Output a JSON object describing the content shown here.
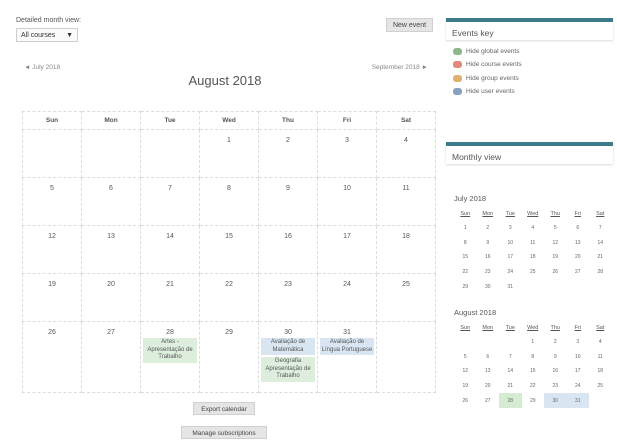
{
  "main": {
    "detailed_label": "Detailed month view:",
    "course_select": "All courses",
    "new_event": "New event",
    "prev_month": "◄ July 2018",
    "next_month": "September 2018 ►",
    "month_title": "August 2018",
    "weekdays": [
      "Sun",
      "Mon",
      "Tue",
      "Wed",
      "Thu",
      "Fri",
      "Sat"
    ],
    "weeks": [
      [
        {
          "d": ""
        },
        {
          "d": ""
        },
        {
          "d": ""
        },
        {
          "d": "1"
        },
        {
          "d": "2"
        },
        {
          "d": "3"
        },
        {
          "d": "4"
        }
      ],
      [
        {
          "d": "5"
        },
        {
          "d": "6"
        },
        {
          "d": "7"
        },
        {
          "d": "8"
        },
        {
          "d": "9"
        },
        {
          "d": "10"
        },
        {
          "d": "11"
        }
      ],
      [
        {
          "d": "12"
        },
        {
          "d": "13"
        },
        {
          "d": "14"
        },
        {
          "d": "15"
        },
        {
          "d": "16"
        },
        {
          "d": "17"
        },
        {
          "d": "18"
        }
      ],
      [
        {
          "d": "19"
        },
        {
          "d": "20"
        },
        {
          "d": "21"
        },
        {
          "d": "22"
        },
        {
          "d": "23"
        },
        {
          "d": "24"
        },
        {
          "d": "25"
        }
      ],
      [
        {
          "d": "26"
        },
        {
          "d": "27"
        },
        {
          "d": "28",
          "events": [
            {
              "t": "Artes - Apresentação de Trabalho",
              "type": "course"
            }
          ]
        },
        {
          "d": "29"
        },
        {
          "d": "30",
          "events": [
            {
              "t": "Avaliação de Matemática",
              "type": "site"
            },
            {
              "t": "Geografia Apresentação de Trabalho",
              "type": "course"
            }
          ]
        },
        {
          "d": "31",
          "events": [
            {
              "t": "Avaliação de Língua Portuguese",
              "type": "site"
            }
          ]
        },
        {
          "d": ""
        }
      ]
    ],
    "export_calendar": "Export calendar",
    "manage_subscriptions": "Manage subscriptions"
  },
  "events_key": {
    "title": "Events key",
    "items": [
      {
        "label": "Hide global events",
        "color": "#8fb88a"
      },
      {
        "label": "Hide course events",
        "color": "#e08a7a"
      },
      {
        "label": "Hide group events",
        "color": "#e0b070"
      },
      {
        "label": "Hide user events",
        "color": "#8aa0c0"
      }
    ]
  },
  "monthly_view": {
    "title": "Monthly view",
    "weekdays": [
      "Sun",
      "Mon",
      "Tue",
      "Wed",
      "Thu",
      "Fri",
      "Sat"
    ],
    "months": [
      {
        "title": "July 2018",
        "weeks": [
          [
            "1",
            "2",
            "3",
            "4",
            "5",
            "6",
            "7"
          ],
          [
            "8",
            "9",
            "10",
            "11",
            "12",
            "13",
            "14"
          ],
          [
            "15",
            "16",
            "17",
            "18",
            "19",
            "20",
            "21"
          ],
          [
            "22",
            "23",
            "24",
            "25",
            "26",
            "27",
            "28"
          ],
          [
            "29",
            "30",
            "31",
            "",
            "",
            "",
            ""
          ]
        ],
        "highlights": {}
      },
      {
        "title": "August 2018",
        "weeks": [
          [
            "",
            "",
            "",
            "1",
            "2",
            "3",
            "4"
          ],
          [
            "5",
            "6",
            "7",
            "8",
            "9",
            "10",
            "11"
          ],
          [
            "12",
            "13",
            "14",
            "15",
            "16",
            "17",
            "18"
          ],
          [
            "19",
            "20",
            "21",
            "22",
            "23",
            "24",
            "25"
          ],
          [
            "26",
            "27",
            "28",
            "29",
            "30",
            "31",
            ""
          ]
        ],
        "highlights": {
          "28": "course",
          "30": "site",
          "31": "site"
        }
      }
    ]
  }
}
